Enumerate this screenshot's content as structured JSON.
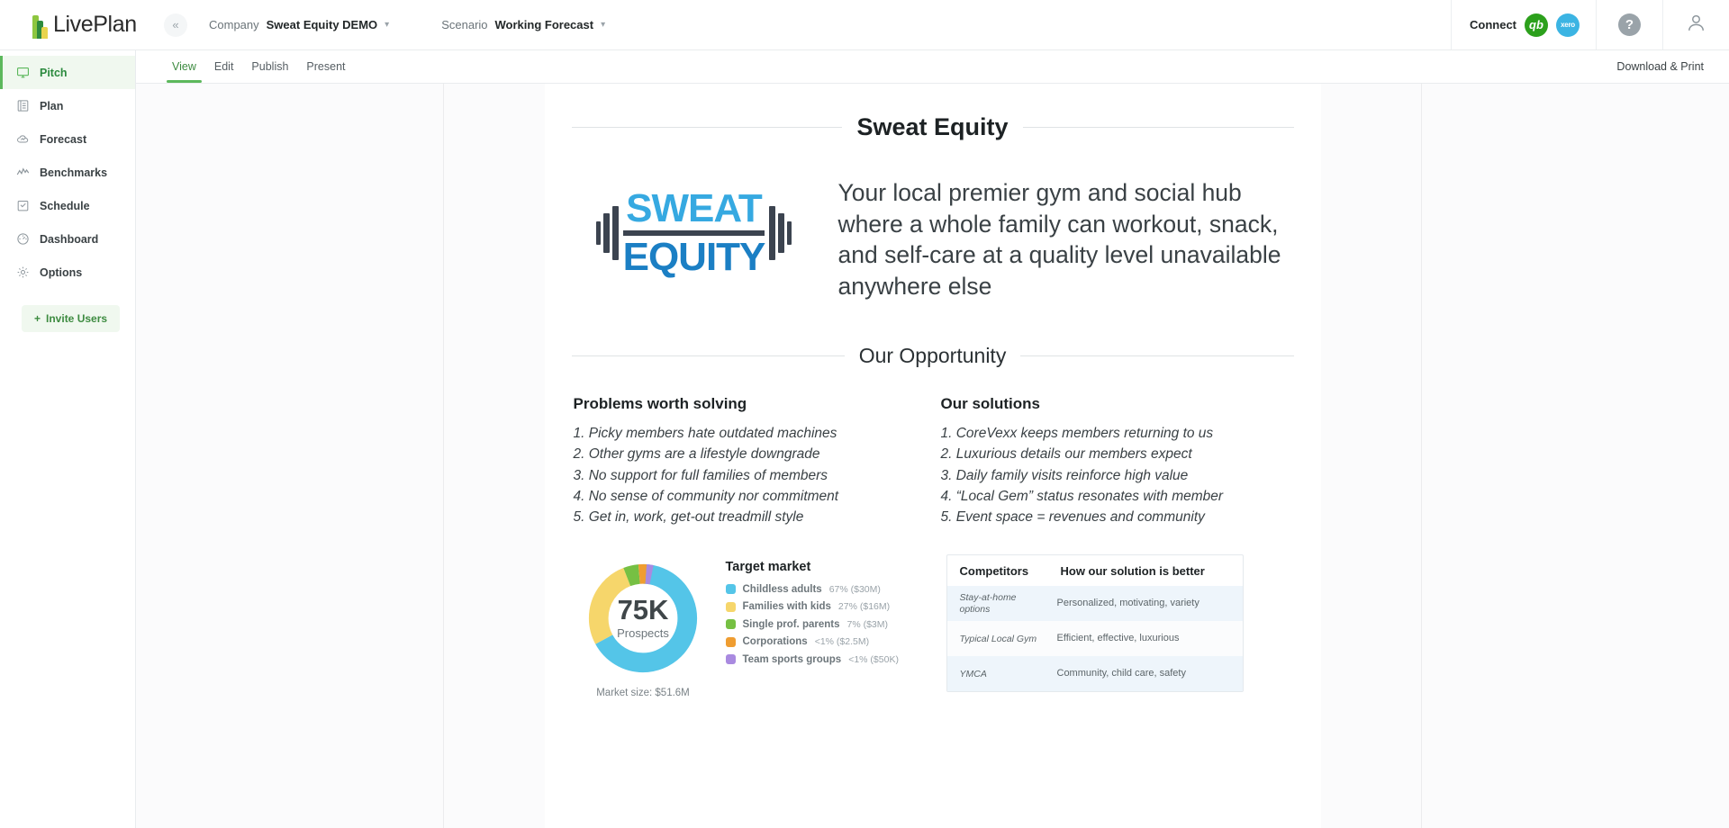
{
  "topbar": {
    "brand_name": "LivePlan",
    "collapse_icon": "chevron-double-left-icon",
    "company_label": "Company",
    "company_value": "Sweat Equity DEMO",
    "scenario_label": "Scenario",
    "scenario_value": "Working Forecast",
    "connect_label": "Connect",
    "quickbooks_icon": "quickbooks-icon",
    "quickbooks_text": "qb",
    "xero_icon": "xero-icon",
    "xero_text": "xero",
    "help_icon": "help-icon",
    "help_text": "?",
    "account_icon": "user-account-icon"
  },
  "sidebar": {
    "items": [
      {
        "label": "Pitch",
        "icon": "monitor-icon",
        "active": true
      },
      {
        "label": "Plan",
        "icon": "document-list-icon",
        "active": false
      },
      {
        "label": "Forecast",
        "icon": "cloud-chart-icon",
        "active": false
      },
      {
        "label": "Benchmarks",
        "icon": "line-chart-icon",
        "active": false
      },
      {
        "label": "Schedule",
        "icon": "checkbox-calendar-icon",
        "active": false
      },
      {
        "label": "Dashboard",
        "icon": "gauge-icon",
        "active": false
      },
      {
        "label": "Options",
        "icon": "gear-icon",
        "active": false
      }
    ],
    "invite_label": "Invite Users",
    "invite_plus": "+"
  },
  "tabbar": {
    "tabs": [
      {
        "label": "View",
        "active": true
      },
      {
        "label": "Edit",
        "active": false
      },
      {
        "label": "Publish",
        "active": false
      },
      {
        "label": "Present",
        "active": false
      }
    ],
    "download_label": "Download & Print"
  },
  "pitch": {
    "title": "Sweat Equity",
    "logo": {
      "top_word": "SWEAT",
      "bottom_word": "EQUITY",
      "top_color": "#36a9e1",
      "bottom_color": "#1b7fc4",
      "plate_color": "#3c4450"
    },
    "tagline": "Your local premier gym and social hub where a whole family can workout, snack, and self-care at a quality level unavailable anywhere else",
    "opportunity_title": "Our Opportunity",
    "problems": {
      "heading": "Problems worth solving",
      "items": [
        "1. Picky members hate outdated machines",
        "2. Other gyms are a lifestyle downgrade",
        "3. No support for full families of members",
        "4. No sense of community nor commitment",
        "5. Get in, work, get-out treadmill style"
      ]
    },
    "solutions": {
      "heading": "Our solutions",
      "items": [
        "1. CoreVexx keeps members returning to us",
        "2. Luxurious details our members expect",
        "3. Daily family visits reinforce high value",
        "4. “Local Gem” status resonates with member",
        "5. Event space = revenues and community"
      ]
    },
    "target_market": {
      "heading": "Target market",
      "center_value": "75K",
      "center_label": "Prospects",
      "market_size": "Market size: $51.6M"
    },
    "competitors": {
      "col1_header": "Competitors",
      "col2_header": "How our solution is better",
      "rows": [
        {
          "competitor": "Stay-at-home options",
          "advantage": "Personalized, motivating, variety"
        },
        {
          "competitor": "Typical Local Gym",
          "advantage": "Efficient, effective, luxurious"
        },
        {
          "competitor": "YMCA",
          "advantage": "Community, child care, safety"
        }
      ]
    }
  },
  "chart_data": {
    "type": "pie",
    "title": "Target market",
    "center_value": "75K",
    "center_label": "Prospects",
    "footnote": "Market size: $51.6M",
    "categories": [
      "Childless adults",
      "Families with kids",
      "Single prof. parents",
      "Corporations",
      "Team sports groups"
    ],
    "values": [
      67,
      27,
      7,
      0.5,
      0.5
    ],
    "value_labels": [
      "67% ($30M)",
      "27% ($16M)",
      "7% ($3M)",
      "<1% ($2.5M)",
      "<1% ($50K)"
    ],
    "colors": [
      "#54c5e8",
      "#f6d66b",
      "#76c043",
      "#ef9d31",
      "#a98ae0"
    ],
    "legend_position": "right",
    "donut": true
  }
}
